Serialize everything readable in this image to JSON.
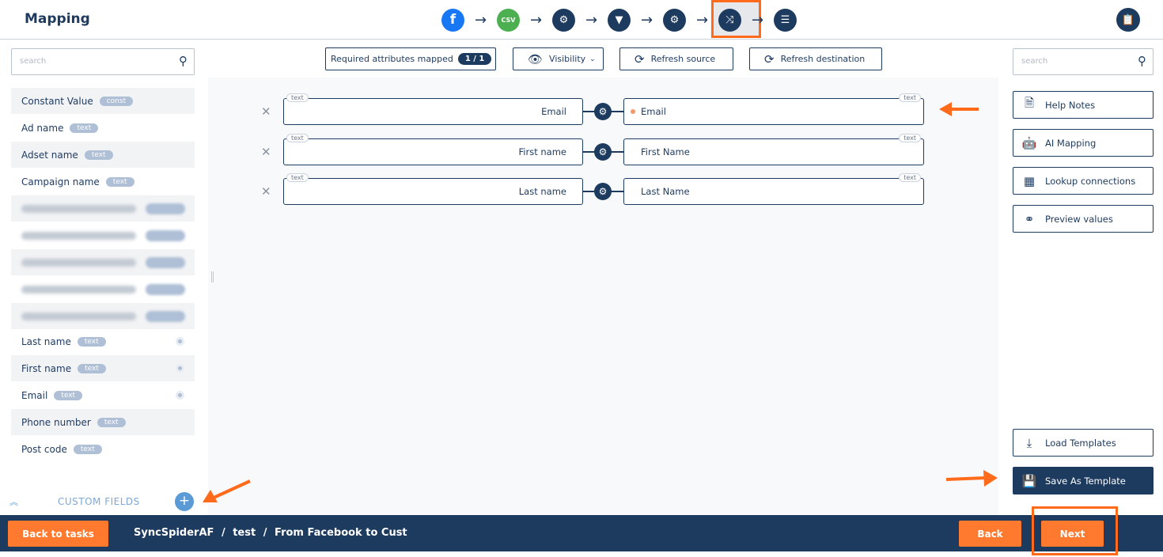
{
  "header": {
    "title": "Mapping",
    "steps": [
      {
        "name": "facebook",
        "glyph": "f"
      },
      {
        "name": "csv",
        "glyph": "CSV"
      },
      {
        "name": "settings",
        "glyph": "⚙"
      },
      {
        "name": "filter",
        "glyph": "▼"
      },
      {
        "name": "settings",
        "glyph": "⚙"
      },
      {
        "name": "mapping",
        "glyph": "⤨"
      },
      {
        "name": "sliders",
        "glyph": "☰"
      }
    ],
    "step_arrow": "→",
    "clipboard_glyph": "📋"
  },
  "left_panel": {
    "search_placeholder": "search",
    "attributes": [
      {
        "label": "Constant Value",
        "type": "const"
      },
      {
        "label": "Ad name",
        "type": "text"
      },
      {
        "label": "Adset name",
        "type": "text"
      },
      {
        "label": "Campaign name",
        "type": "text"
      },
      {
        "label": "Last name",
        "type": "text"
      },
      {
        "label": "First name",
        "type": "text"
      },
      {
        "label": "Email",
        "type": "text"
      },
      {
        "label": "Phone number",
        "type": "text"
      },
      {
        "label": "Post code",
        "type": "text"
      }
    ],
    "custom_fields_label": "CUSTOM FIELDS",
    "add_glyph": "+"
  },
  "toolbar": {
    "required_label": "Required attributes mapped",
    "required_count": "1 / 1",
    "visibility_label": "Visibility",
    "refresh_source_label": "Refresh source",
    "refresh_destination_label": "Refresh destination"
  },
  "mappings": [
    {
      "source": "Email",
      "source_type": "text",
      "destination": "Email",
      "destination_type": "text"
    },
    {
      "source": "First name",
      "source_type": "text",
      "destination": "First Name",
      "destination_type": "text"
    },
    {
      "source": "Last name",
      "source_type": "text",
      "destination": "Last Name",
      "destination_type": "text"
    }
  ],
  "right_panel": {
    "search_placeholder": "search",
    "help_notes": "Help Notes",
    "ai_mapping": "AI Mapping",
    "lookup_connections": "Lookup connections",
    "preview_values": "Preview values",
    "load_templates": "Load Templates",
    "save_as_template": "Save As Template"
  },
  "footer": {
    "back_to_tasks": "Back to tasks",
    "crumb_1": "SyncSpiderAF",
    "crumb_2": "test",
    "crumb_3": "From Facebook to Cust",
    "separator": "/",
    "back": "Back",
    "next": "Next"
  },
  "colors": {
    "primary": "#1d3a5f",
    "accent": "#ff7a2e",
    "annotation": "#ff6b1a"
  }
}
